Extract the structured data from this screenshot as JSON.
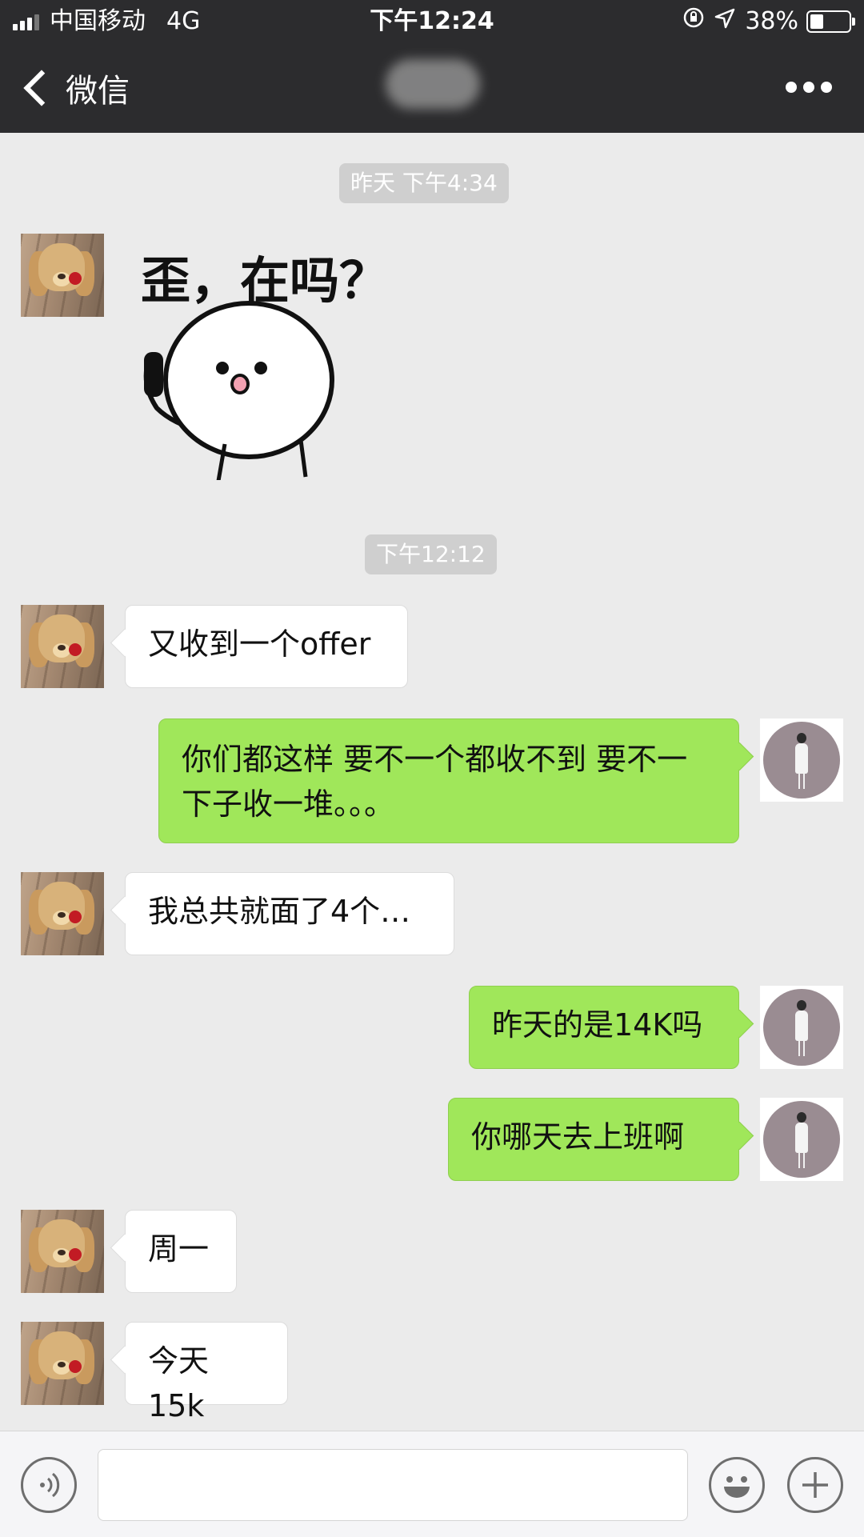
{
  "status_bar": {
    "carrier": "中国移动",
    "network": "4G",
    "time": "下午12:24",
    "battery": "38%",
    "battery_level": 0.38,
    "icons": [
      "signal-icon",
      "rotation-lock-icon",
      "location-arrow-icon",
      "battery-icon"
    ]
  },
  "nav": {
    "back_label": "微信",
    "title_obscured": true,
    "more_icon": "more-dots-icon"
  },
  "timestamps": [
    "昨天 下午4:34",
    "下午12:12"
  ],
  "sticker": {
    "caption": "歪，在吗？"
  },
  "messages": [
    {
      "from": "them",
      "text": "又收到一个offer"
    },
    {
      "from": "me",
      "text": "你们都这样 要不一个都收不到  要不一下子收一堆。。。"
    },
    {
      "from": "them",
      "text": "我总共就面了4个…"
    },
    {
      "from": "me",
      "text": "昨天的是14K吗"
    },
    {
      "from": "me",
      "text": "你哪天去上班啊"
    },
    {
      "from": "them",
      "text": "周一"
    },
    {
      "from": "them",
      "text": "今天15k"
    }
  ],
  "input_bar": {
    "voice_icon": "voice-icon",
    "input_value": "",
    "emoji_icon": "emoji-icon",
    "plus_icon": "plus-icon"
  },
  "colors": {
    "nav_bg": "#2c2c2e",
    "chat_bg": "#ebebeb",
    "outgoing_bubble": "#a0e75a",
    "incoming_bubble": "#ffffff",
    "timestamp_chip": "#cfcfcf"
  }
}
